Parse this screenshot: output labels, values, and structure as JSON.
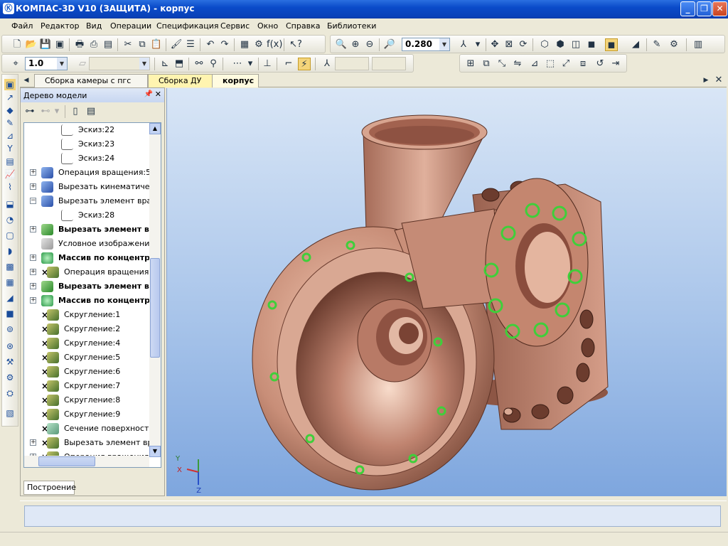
{
  "window": {
    "title": "КОМПАС-3D V10 (ЗАЩИТА) - корпус",
    "app_icon": "Ⓚ"
  },
  "menu": [
    "Файл",
    "Редактор",
    "Вид",
    "Операции",
    "Спецификация",
    "Сервис",
    "Окно",
    "Справка",
    "Библиотеки"
  ],
  "toolbar_top": {
    "zoom_value": "0.280"
  },
  "toolbar_second": {
    "step_value": "1.0"
  },
  "tabs": [
    {
      "label": "Сборка камеры с пгс"
    },
    {
      "label": "Сборка ДУ"
    },
    {
      "label": "корпус"
    }
  ],
  "tree": {
    "header": "Дерево модели",
    "items": [
      {
        "label": "Эскиз:22",
        "kind": "sketch",
        "expand": "",
        "x_mark": false,
        "bold": false
      },
      {
        "label": "Эскиз:23",
        "kind": "sketch",
        "expand": "",
        "x_mark": false,
        "bold": false
      },
      {
        "label": "Эскиз:24",
        "kind": "sketch",
        "expand": "",
        "x_mark": false,
        "bold": false
      },
      {
        "label": "Операция вращения:5",
        "kind": "blue",
        "expand": "+",
        "x_mark": false,
        "bold": false
      },
      {
        "label": "Вырезать кинематичес",
        "kind": "blue",
        "expand": "+",
        "x_mark": false,
        "bold": false
      },
      {
        "label": "Вырезать элемент вра",
        "kind": "blue",
        "expand": "−",
        "x_mark": false,
        "bold": false
      },
      {
        "label": "Эскиз:28",
        "kind": "sketch",
        "expand": "",
        "x_mark": false,
        "bold": false
      },
      {
        "label": "Вырезать элемент в",
        "kind": "green",
        "expand": "+",
        "x_mark": false,
        "bold": true
      },
      {
        "label": "Условное изображение",
        "kind": "gray",
        "expand": "",
        "x_mark": false,
        "bold": false
      },
      {
        "label": "Массив по концентр",
        "kind": "teal",
        "expand": "+",
        "x_mark": false,
        "bold": true
      },
      {
        "label": "Операция вращения:(",
        "kind": "olive",
        "expand": "+",
        "x_mark": true,
        "bold": false
      },
      {
        "label": "Вырезать элемент в",
        "kind": "green",
        "expand": "+",
        "x_mark": false,
        "bold": true
      },
      {
        "label": "Массив по концентр",
        "kind": "teal",
        "expand": "+",
        "x_mark": false,
        "bold": true
      },
      {
        "label": "Скругление:1",
        "kind": "olive",
        "expand": "",
        "x_mark": true,
        "bold": false
      },
      {
        "label": "Скругление:2",
        "kind": "olive",
        "expand": "",
        "x_mark": true,
        "bold": false
      },
      {
        "label": "Скругление:4",
        "kind": "olive",
        "expand": "",
        "x_mark": true,
        "bold": false
      },
      {
        "label": "Скругление:5",
        "kind": "olive",
        "expand": "",
        "x_mark": true,
        "bold": false
      },
      {
        "label": "Скругление:6",
        "kind": "olive",
        "expand": "",
        "x_mark": true,
        "bold": false
      },
      {
        "label": "Скругление:7",
        "kind": "olive",
        "expand": "",
        "x_mark": true,
        "bold": false
      },
      {
        "label": "Скругление:8",
        "kind": "olive",
        "expand": "",
        "x_mark": true,
        "bold": false
      },
      {
        "label": "Скругление:9",
        "kind": "olive",
        "expand": "",
        "x_mark": true,
        "bold": false
      },
      {
        "label": "Сечение поверхность",
        "kind": "section",
        "expand": "",
        "x_mark": true,
        "bold": false
      },
      {
        "label": "Вырезать элемент вра",
        "kind": "olive",
        "expand": "+",
        "x_mark": true,
        "bold": false
      },
      {
        "label": "Операция вращения:",
        "kind": "olive",
        "expand": "+",
        "x_mark": true,
        "bold": false
      }
    ],
    "bottom_tab": "Построение"
  },
  "viewport": {
    "axes": {
      "x": "X",
      "y": "Y",
      "z": "Z"
    },
    "colors": {
      "background_top": "#d9e6f6",
      "background_bottom": "#7ea6de",
      "part": "#c88e78",
      "selected_holes": "#3fcf3a"
    }
  },
  "status": {
    "text": ""
  }
}
